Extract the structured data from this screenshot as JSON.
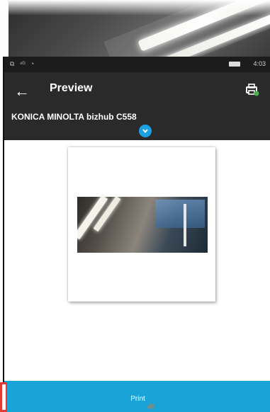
{
  "status_bar": {
    "left_icons": [
      "sim-icon",
      "signal-icon",
      "wifi-icon"
    ],
    "left_glyphs": [
      "⧉",
      "⁴ᴳ",
      "◔"
    ],
    "battery_icon": "battery-icon",
    "time": "4:03"
  },
  "app_bar": {
    "back_icon": "arrow-left-icon",
    "back_glyph": "←",
    "title": "Preview",
    "settings_icon": "print-settings-icon",
    "printer_name": "KONICA MINOLTA bizhub C558",
    "expand_icon": "chevron-down-icon"
  },
  "preview": {
    "page_image": "photo-thumbnail"
  },
  "footer": {
    "print_label": "Print",
    "hand_icon": "hand-pointer-icon"
  },
  "colors": {
    "app_bar": "#2a2a2a",
    "status_bar": "#1c1c1c",
    "accent": "#1aa3d6",
    "expand_button": "#1ba1e2",
    "marker": "#e53935"
  }
}
